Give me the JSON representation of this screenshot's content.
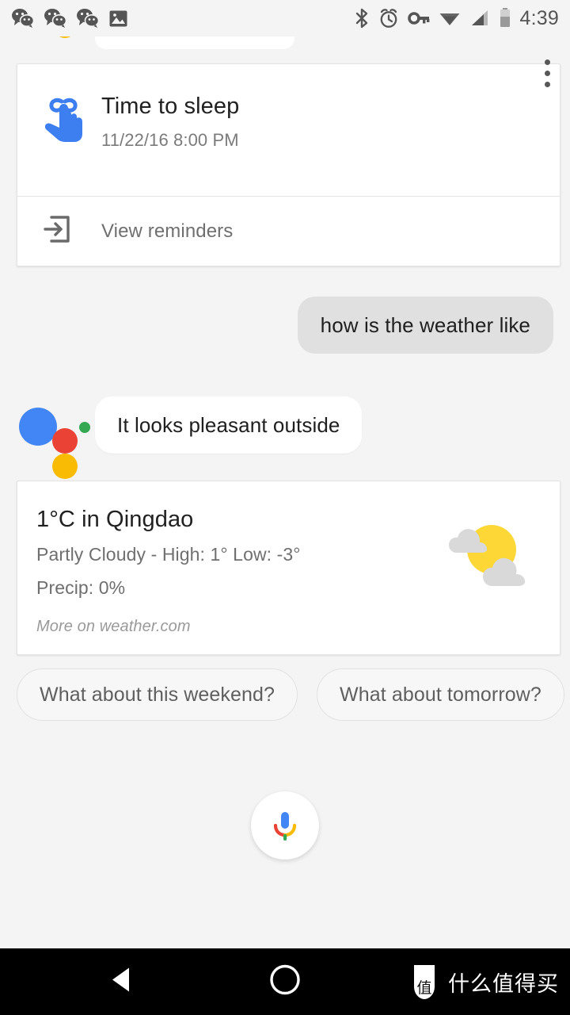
{
  "status_bar": {
    "time": "4:39",
    "left_icons": [
      "wechat-notification-icon",
      "wechat-notification-icon",
      "wechat-notification-icon",
      "screenshot-image-icon"
    ],
    "right_icons": [
      "bluetooth-icon",
      "alarm-clock-icon",
      "vpn-key-icon",
      "wifi-icon",
      "cellular-signal-icon",
      "battery-icon"
    ]
  },
  "reminder_card": {
    "icon": "reminder-finger-string-icon",
    "title": "Time to sleep",
    "datetime": "11/22/16 8:00 PM",
    "overflow_icon": "overflow-menu-icon",
    "action_icon": "open-in-app-icon",
    "action_label": "View reminders"
  },
  "conversation": {
    "user_query": "how is the weather like",
    "assistant_reply": "It looks pleasant outside",
    "assistant_logo": "google-assistant-logo"
  },
  "weather_card": {
    "headline": "1°C in Qingdao",
    "condition": "Partly Cloudy - High: 1° Low: -3°",
    "precip": "Precip: 0%",
    "source": "More on weather.com",
    "icon": "partly-cloudy-icon",
    "temperature": "1",
    "unit": "°C",
    "location": "Qingdao",
    "high": "1°",
    "low": "-3°",
    "precip_value": "0%"
  },
  "suggestion_chips": [
    {
      "label": "What about this weekend?"
    },
    {
      "label": "What about tomorrow?"
    }
  ],
  "mic_button": {
    "icon": "google-microphone-icon"
  },
  "nav_bar": {
    "back_icon": "back-triangle-icon",
    "home_icon": "home-circle-icon",
    "watermark_text": "什么值得买",
    "watermark_logo": "smzdm-logo-icon"
  },
  "colors": {
    "background": "#f4f4f4",
    "card": "#ffffff",
    "user_bubble": "#e0e0e0",
    "google_blue": "#4285f4",
    "google_red": "#ea4335",
    "google_yellow": "#fabb05",
    "google_green": "#34a853",
    "sun_yellow": "#fcd736",
    "cloud_gray": "#d4d4d4",
    "nav_bar": "#000000"
  }
}
